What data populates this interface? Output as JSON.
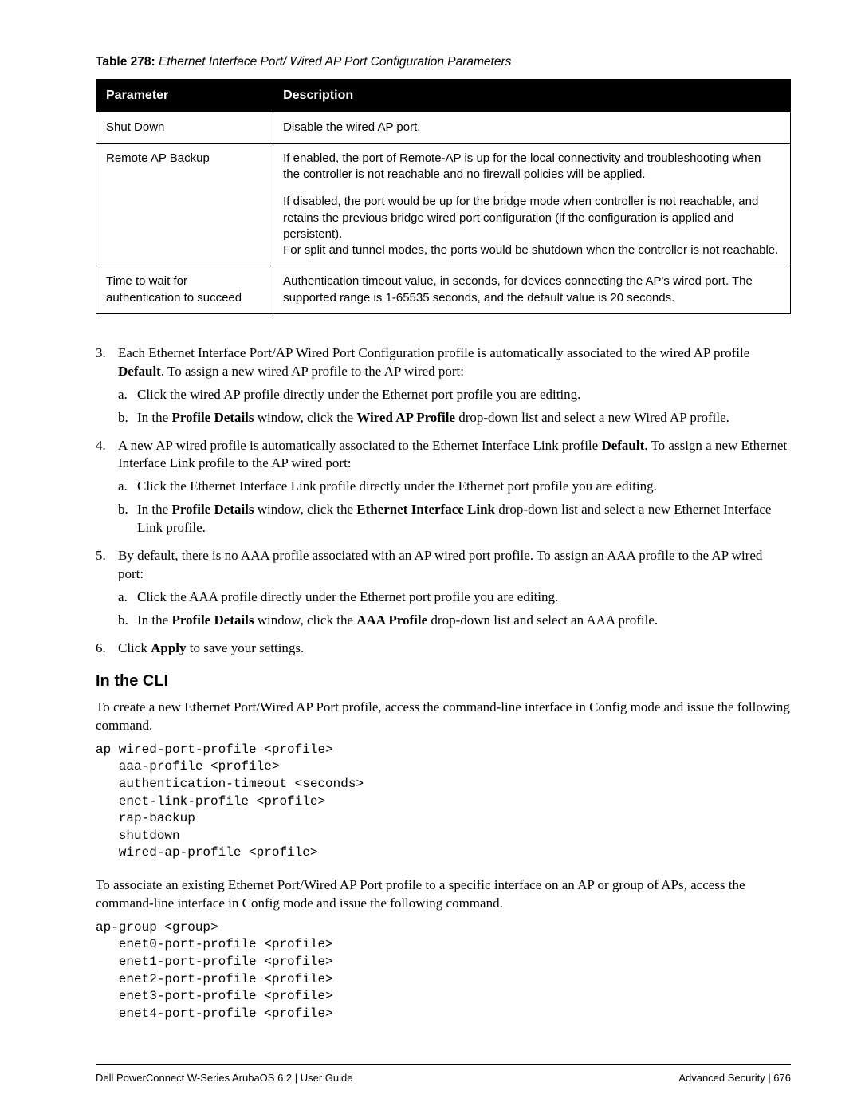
{
  "table": {
    "caption_prefix": "Table 278:",
    "caption_title": " Ethernet Interface Port/ Wired AP Port Configuration Parameters",
    "headers": [
      "Parameter",
      "Description"
    ],
    "rows": [
      {
        "param": "Shut Down",
        "desc": "Disable the wired AP port."
      },
      {
        "param": "Remote AP Backup",
        "desc_p1": "If enabled, the port of Remote-AP is up for the local connectivity and troubleshooting when the controller is not reachable and no firewall policies will be applied.",
        "desc_p2": "If disabled, the port would be up for the bridge mode when controller is not reachable, and retains the previous bridge wired port configuration (if the configuration is applied and persistent).",
        "desc_p3": "For split and tunnel modes, the ports would be shutdown when the controller is not reachable."
      },
      {
        "param": "Time to wait for authentication to succeed",
        "desc": "Authentication timeout value, in seconds, for devices connecting the AP's wired port. The supported range is 1-65535 seconds, and the default value is 20 seconds."
      }
    ]
  },
  "steps": {
    "s3": {
      "num": "3.",
      "text_a": "Each Ethernet Interface Port/AP Wired Port Configuration profile is automatically associated to the wired AP profile ",
      "bold1": "Default",
      "text_b": ". To assign a new wired AP profile to the AP wired port:",
      "a": {
        "num": "a.",
        "text": "Click the wired AP profile directly under the Ethernet port profile you are editing."
      },
      "b": {
        "num": "b.",
        "t1": "In the ",
        "b1": "Profile Details",
        "t2": " window, click the ",
        "b2": "Wired AP Profile",
        "t3": " drop-down list and select a new Wired AP profile."
      }
    },
    "s4": {
      "num": "4.",
      "t1": "A new AP wired profile is automatically associated to the Ethernet Interface Link profile ",
      "b1": "Default",
      "t2": ". To assign a new Ethernet Interface Link profile to the AP wired port:",
      "a": {
        "num": "a.",
        "text": "Click the Ethernet Interface Link profile directly under the Ethernet port profile you are editing."
      },
      "b": {
        "num": "b.",
        "t1": "In the ",
        "b1": "Profile Details",
        "t2": " window, click the ",
        "b2": "Ethernet Interface Link",
        "t3": " drop-down list and select a new Ethernet Interface Link profile."
      }
    },
    "s5": {
      "num": "5.",
      "text": "By default, there is no AAA profile associated with an AP wired port profile. To assign an AAA profile to the AP wired port:",
      "a": {
        "num": "a.",
        "text": "Click the AAA profile directly under the Ethernet port profile you are editing."
      },
      "b": {
        "num": "b.",
        "t1": "In the ",
        "b1": "Profile Details",
        "t2": " window, click the ",
        "b2": "AAA Profile",
        "t3": " drop-down list and select an AAA profile."
      }
    },
    "s6": {
      "num": "6.",
      "t1": "Click ",
      "b1": "Apply",
      "t2": " to save your settings."
    }
  },
  "cli": {
    "heading": "In the CLI",
    "para1": "To create a new Ethernet Port/Wired AP Port profile, access the command-line interface in Config mode and issue the following command.",
    "code1": "ap wired-port-profile <profile>\n   aaa-profile <profile>\n   authentication-timeout <seconds>\n   enet-link-profile <profile>\n   rap-backup\n   shutdown\n   wired-ap-profile <profile>",
    "para2": "To associate an existing Ethernet Port/Wired AP Port profile to a specific interface on an AP or group of APs, access the command-line interface in Config mode and issue the following command.",
    "code2": "ap-group <group>\n   enet0-port-profile <profile>\n   enet1-port-profile <profile>\n   enet2-port-profile <profile>\n   enet3-port-profile <profile>\n   enet4-port-profile <profile>"
  },
  "footer": {
    "left": "Dell PowerConnect W-Series ArubaOS 6.2  |  User Guide",
    "right": "Advanced Security  |  676"
  }
}
